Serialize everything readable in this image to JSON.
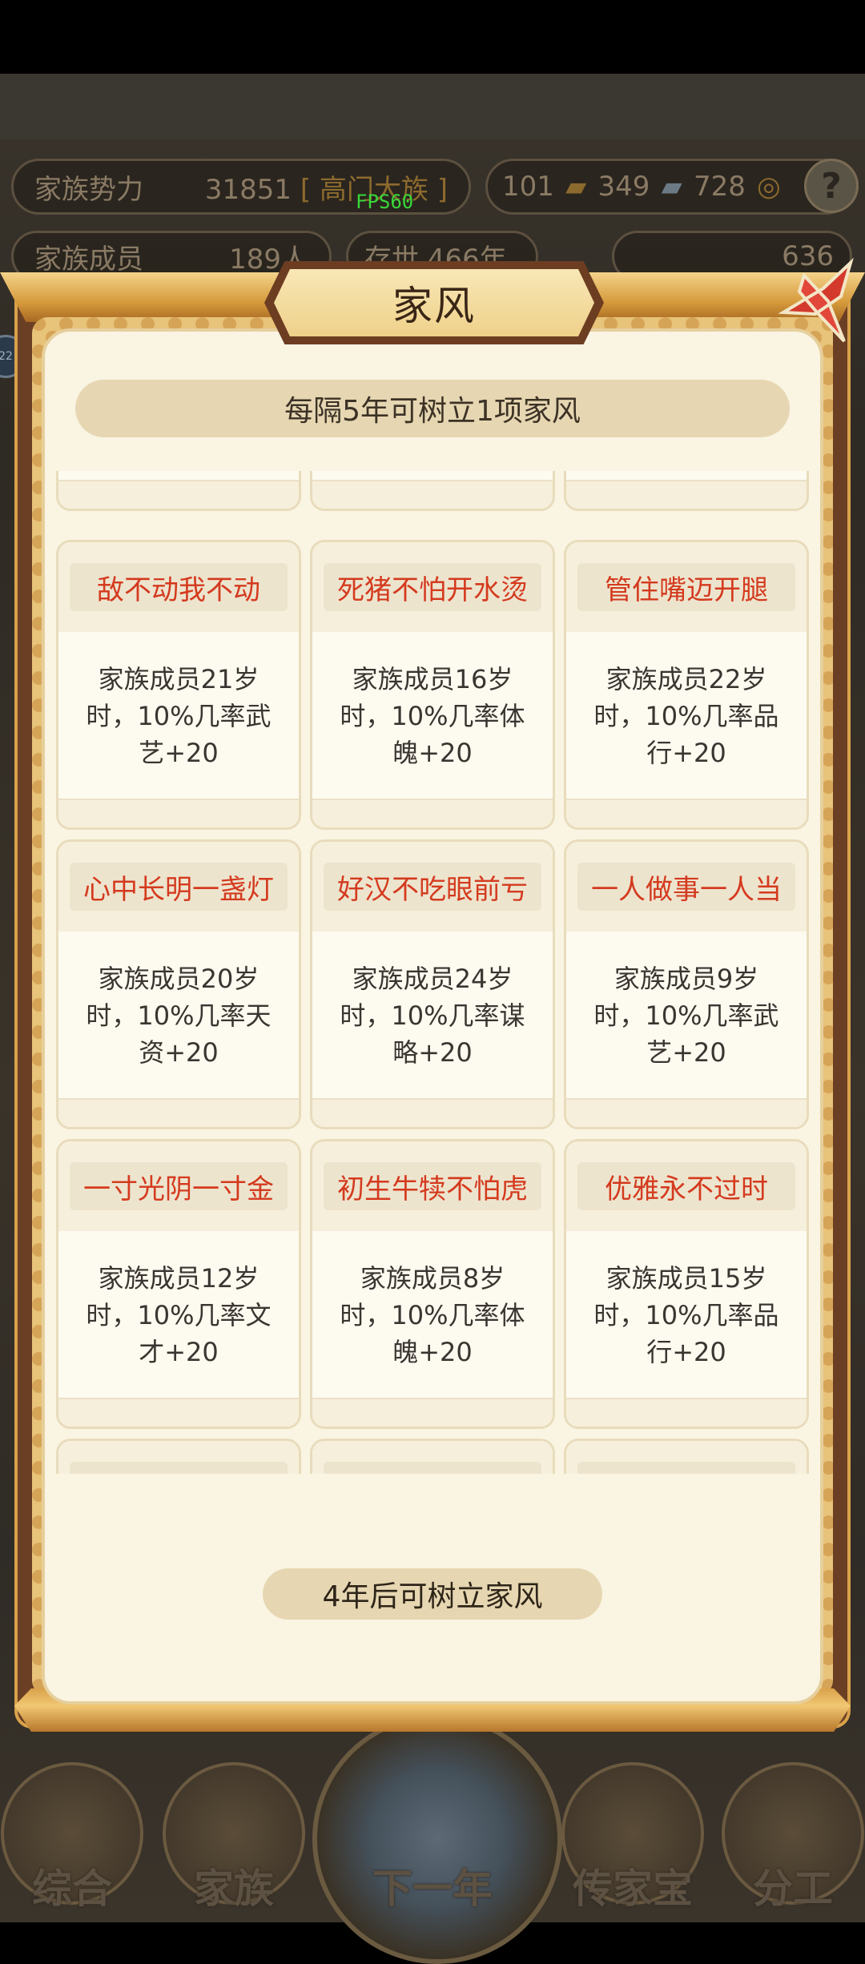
{
  "hud": {
    "clan_power_label": "家族势力",
    "clan_power_value": "31851",
    "clan_rank": "[ 高门大族 ]",
    "res_wood": "101",
    "res_iron": "349",
    "res_coin": "728",
    "help_label": "?",
    "members_label": "家族成员",
    "members_value": "189人",
    "year_label": "存世 466年",
    "money_value": "636",
    "side_badge": "22",
    "fps": "FPS60"
  },
  "dialog": {
    "title": "家风",
    "info": "每隔5年可树立1项家风",
    "footer": "4年后可树立家风"
  },
  "cards": [
    {
      "title": "",
      "desc": ""
    },
    {
      "title": "",
      "desc": ""
    },
    {
      "title": "",
      "desc": ""
    },
    {
      "title": "敌不动我不动",
      "desc": "家族成员21岁时，10%几率武艺+20"
    },
    {
      "title": "死猪不怕开水烫",
      "desc": "家族成员16岁时，10%几率体魄+20"
    },
    {
      "title": "管住嘴迈开腿",
      "desc": "家族成员22岁时，10%几率品行+20"
    },
    {
      "title": "心中长明一盏灯",
      "desc": "家族成员20岁时，10%几率天资+20"
    },
    {
      "title": "好汉不吃眼前亏",
      "desc": "家族成员24岁时，10%几率谋略+20"
    },
    {
      "title": "一人做事一人当",
      "desc": "家族成员9岁时，10%几率武艺+20"
    },
    {
      "title": "一寸光阴一寸金",
      "desc": "家族成员12岁时，10%几率文才+20"
    },
    {
      "title": "初生牛犊不怕虎",
      "desc": "家族成员8岁时，10%几率体魄+20"
    },
    {
      "title": "优雅永不过时",
      "desc": "家族成员15岁时，10%几率品行+20"
    },
    {
      "title": "",
      "desc": ""
    },
    {
      "title": "",
      "desc": ""
    },
    {
      "title": "",
      "desc": ""
    }
  ],
  "nav": [
    "综合",
    "家族",
    "下一年",
    "传家宝",
    "分工"
  ],
  "colors": {
    "card_title_red": "#d43a1e",
    "paper": "#faf4e3",
    "frame_gold": "#d9a24b"
  }
}
